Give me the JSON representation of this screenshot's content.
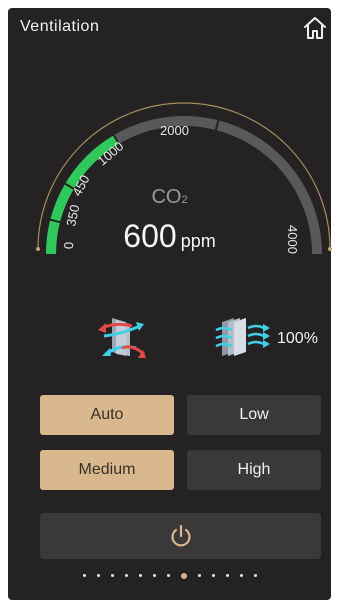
{
  "header": {
    "title": "Ventilation",
    "home_icon": "home-icon"
  },
  "gauge": {
    "label_main": "CO",
    "label_sub": "2",
    "value": "600",
    "unit": "ppm",
    "scale_labels": [
      "0",
      "350",
      "450",
      "1000",
      "2000",
      "4000"
    ],
    "level_fraction": 0.33,
    "colors": {
      "arc_fill": "#2ec95a",
      "arc_track": "#5a5959",
      "outer_arc": "#c8a872"
    }
  },
  "status": {
    "recirculation_icon": "recirculation-icon",
    "fan_icon": "fan-airflow-icon",
    "fan_percent": "100%"
  },
  "modes": [
    {
      "label": "Auto",
      "active": true
    },
    {
      "label": "Low",
      "active": false
    },
    {
      "label": "Medium",
      "active": true
    },
    {
      "label": "High",
      "active": false
    }
  ],
  "power": {
    "icon": "power-icon"
  },
  "pager": {
    "count": 13,
    "current": 8
  },
  "colors": {
    "panel_bg": "#242222",
    "accent": "#d9b88e",
    "button_bg": "#3a3838"
  }
}
